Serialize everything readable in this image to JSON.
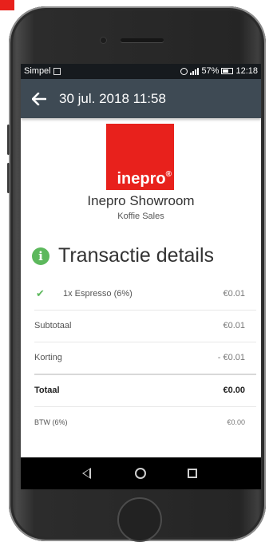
{
  "status_bar": {
    "carrier": "Simpel",
    "battery": "57%",
    "time": "12:18",
    "icons": [
      "sim-icon",
      "alarm-icon",
      "signal-icon",
      "battery-icon"
    ]
  },
  "app_bar": {
    "title": "30 jul. 2018 11:58",
    "back_icon": "arrow-left-icon"
  },
  "store": {
    "logo_text": "inepro",
    "logo_mark": "®",
    "name": "Inepro Showroom",
    "subtitle": "Koffie Sales"
  },
  "section": {
    "title": "Transactie details",
    "icon": "info-circle-icon"
  },
  "items": [
    {
      "label": "1x Espresso (6%)",
      "value": "€0.01",
      "checked": true
    }
  ],
  "totals": {
    "subtotal_label": "Subtotaal",
    "subtotal_value": "€0.01",
    "discount_label": "Korting",
    "discount_value": "- €0.01",
    "total_label": "Totaal",
    "total_value": "€0.00",
    "vat_label": "BTW (6%)",
    "vat_value": "€0.00"
  },
  "colors": {
    "brand_red": "#e8211c",
    "app_bar": "#3e4a54",
    "success_green": "#5cb85c"
  },
  "nav_icons": [
    "nav-back-icon",
    "nav-home-icon",
    "nav-recents-icon"
  ]
}
